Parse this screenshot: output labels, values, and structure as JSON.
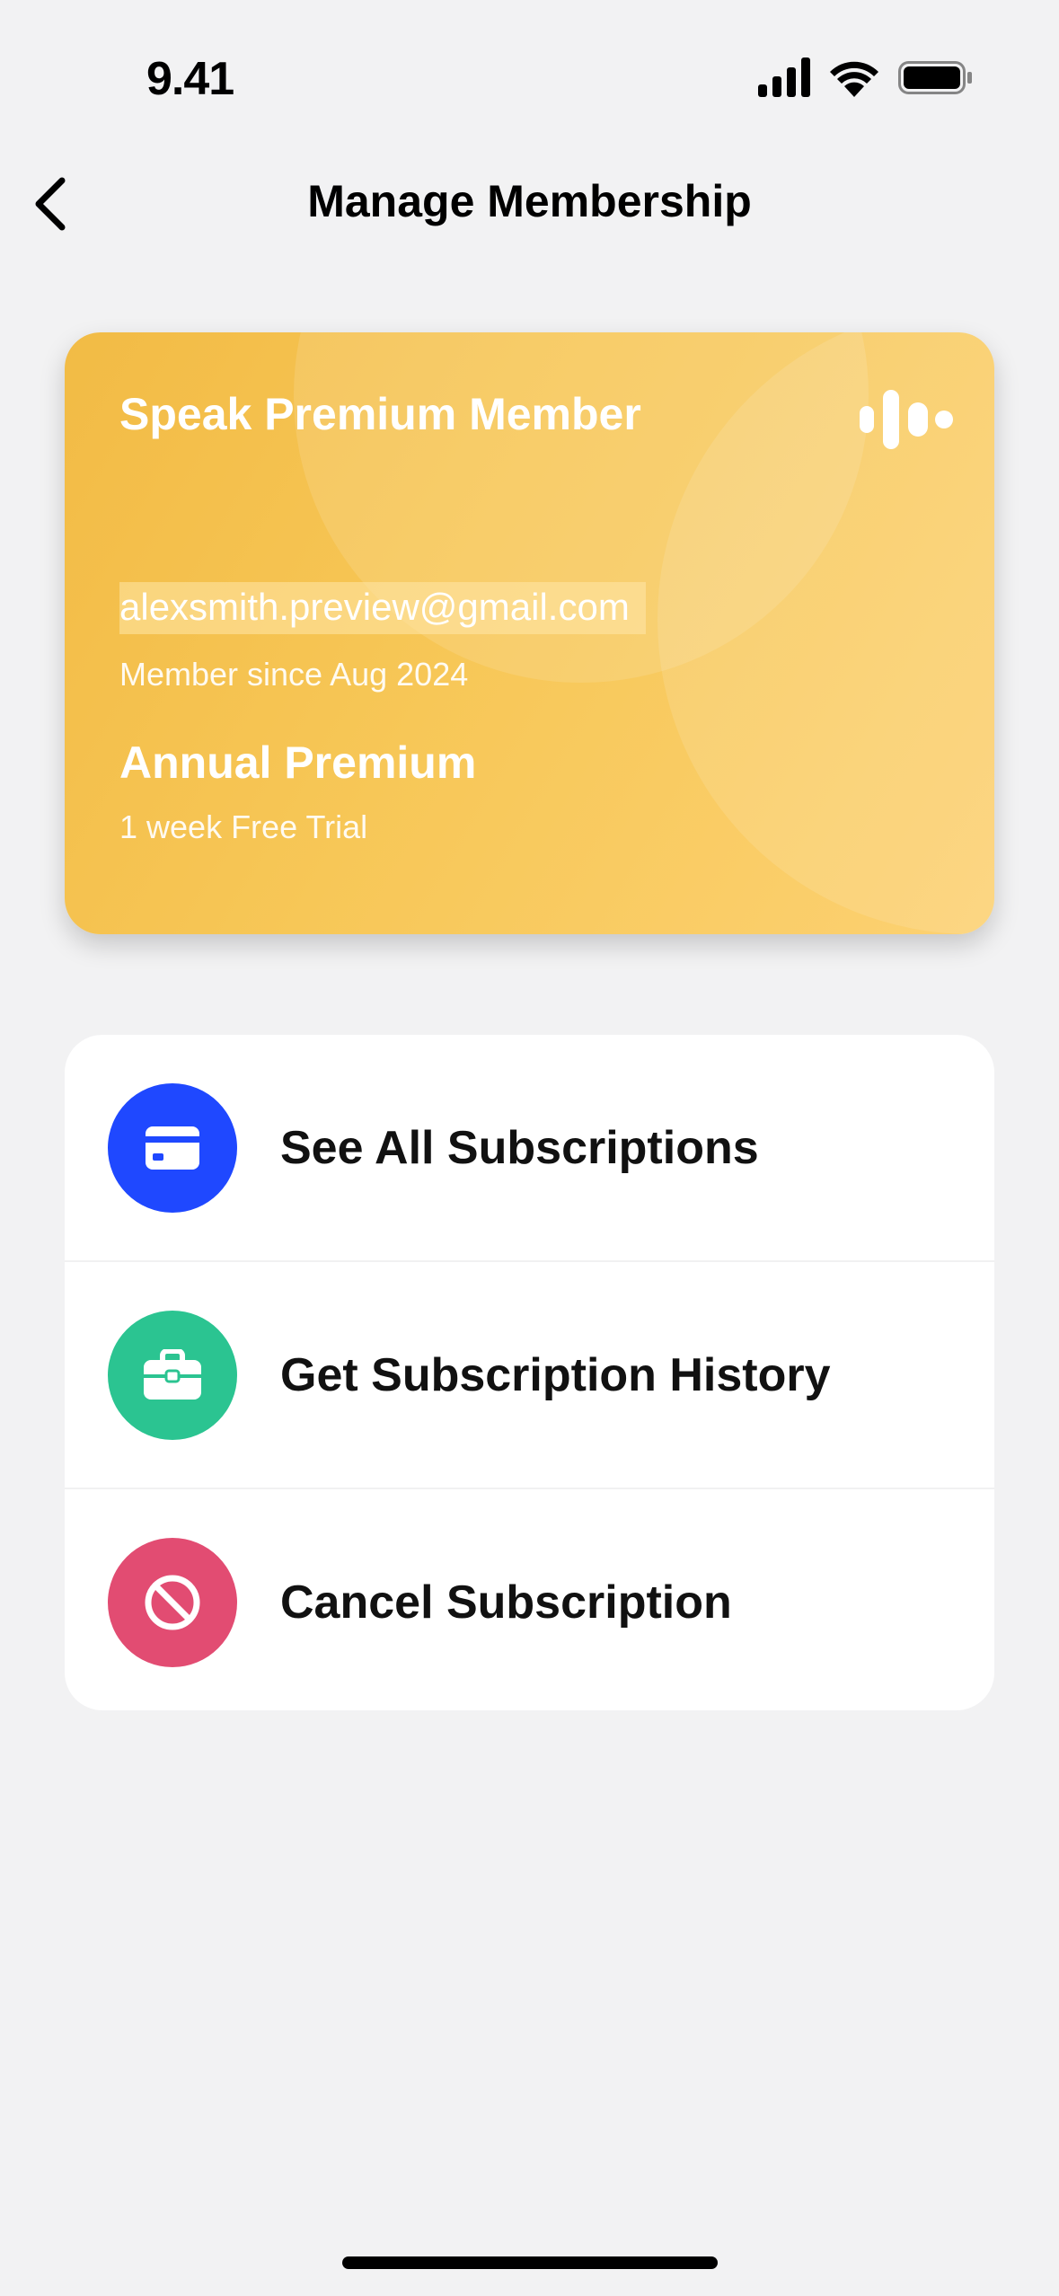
{
  "status_bar": {
    "time": "9.41"
  },
  "nav": {
    "title": "Manage Membership",
    "back_icon": "chevron-left-icon"
  },
  "card": {
    "title": "Speak Premium Member",
    "email": "alexsmith.preview@gmail.com",
    "member_since": "Member since Aug 2024",
    "plan": "Annual Premium",
    "trial": "1 week Free Trial",
    "logo_icon": "speak-waveform-icon",
    "colors": {
      "gradient_start": "#f2bb45",
      "gradient_end": "#fcd172"
    }
  },
  "actions": [
    {
      "label": "See All Subscriptions",
      "icon": "credit-card-icon",
      "color": "#1f48ff"
    },
    {
      "label": "Get Subscription History",
      "icon": "briefcase-icon",
      "color": "#2bc491"
    },
    {
      "label": "Cancel Subscription",
      "icon": "prohibited-icon",
      "color": "#e24c72"
    }
  ]
}
